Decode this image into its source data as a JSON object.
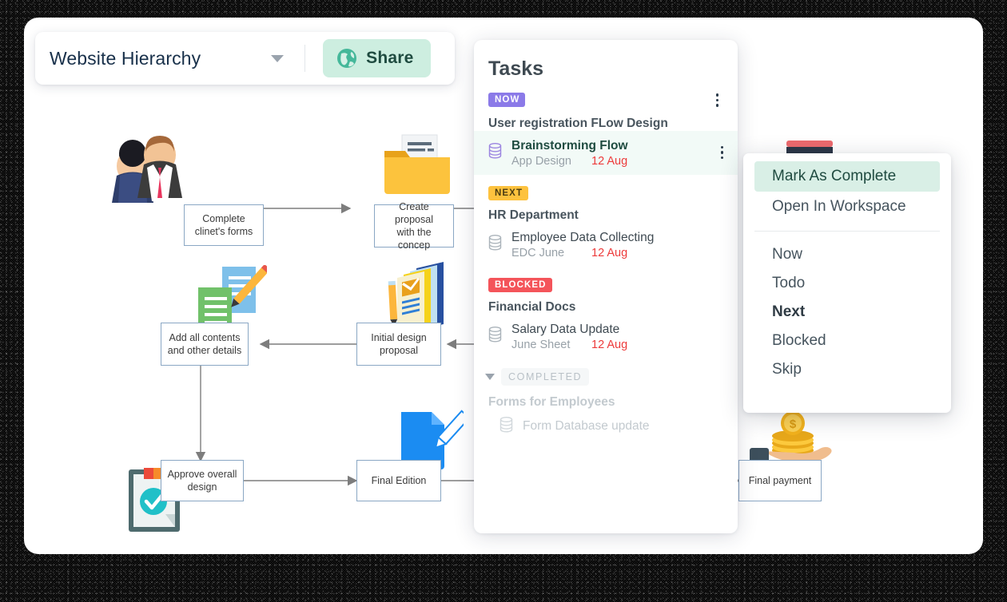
{
  "toolbar": {
    "doc_title": "Website Hierarchy",
    "dropdown_icon": "chevron-down-icon",
    "share_label": "Share",
    "share_icon": "globe-icon",
    "share_bg": "#cdeee0",
    "share_text_color": "#1f4b40"
  },
  "diagram": {
    "nodes": [
      {
        "id": "complete-clients-forms",
        "label": "Complete\nclinet's forms"
      },
      {
        "id": "create-proposal",
        "label": "Create proposal\nwith the concep"
      },
      {
        "id": "add-all-contents",
        "label": "Add all contents\nand other details"
      },
      {
        "id": "initial-design-proposal",
        "label": "Initial design\nproposal"
      },
      {
        "id": "approve-overall-design",
        "label": "Approve overall\ndesign"
      },
      {
        "id": "final-edition",
        "label": "Final Edition"
      },
      {
        "id": "final-payment",
        "label": "Final  payment"
      }
    ],
    "clipart": [
      {
        "id": "business-people-icon"
      },
      {
        "id": "folder-documents-icon"
      },
      {
        "id": "documents-pencil-icon"
      },
      {
        "id": "books-stack-icon"
      },
      {
        "id": "clipboard-check-icon"
      },
      {
        "id": "edit-document-icon"
      },
      {
        "id": "hand-coins-icon"
      }
    ],
    "node_border_color": "#8aa7c4",
    "arrow_color": "#7d7d7d"
  },
  "tasks": {
    "title": "Tasks",
    "kebab_icon": "more-vertical-icon",
    "sections": [
      {
        "badge": "NOW",
        "badge_color": "#8b7ae8",
        "group_title": "User registration FLow Design",
        "has_kebab": true,
        "items": [
          {
            "name": "Brainstorming Flow",
            "sub": "App Design",
            "date": "12 Aug",
            "icon": "database-icon",
            "active": true,
            "kebab_icon": "more-vertical-icon"
          }
        ]
      },
      {
        "badge": "NEXT",
        "badge_color": "#fdc23e",
        "group_title": "HR Department",
        "has_kebab": false,
        "items": [
          {
            "name": "Employee Data Collecting",
            "sub": "EDC June",
            "date": "12 Aug",
            "icon": "database-icon",
            "active": false
          }
        ]
      },
      {
        "badge": "BLOCKED",
        "badge_color": "#f4545a",
        "group_title": "Financial Docs",
        "has_kebab": false,
        "items": [
          {
            "name": "Salary Data Update",
            "sub": "June Sheet",
            "date": "12 Aug",
            "icon": "database-icon",
            "active": false
          }
        ]
      }
    ],
    "completed": {
      "chip_label": "COMPLETED",
      "collapse_icon": "triangle-down-icon",
      "group_title": "Forms for Employees",
      "items": [
        {
          "name": "Form Database update",
          "icon": "database-icon"
        }
      ]
    }
  },
  "context_menu": {
    "primary": [
      {
        "label": "Mark As Complete",
        "highlighted": true
      },
      {
        "label": "Open In Workspace",
        "highlighted": false
      }
    ],
    "statuses": [
      {
        "label": "Now",
        "bold": false
      },
      {
        "label": "Todo",
        "bold": false
      },
      {
        "label": "Next",
        "bold": true
      },
      {
        "label": "Blocked",
        "bold": false
      },
      {
        "label": "Skip",
        "bold": false
      }
    ],
    "highlight_color": "#d9efe6"
  }
}
